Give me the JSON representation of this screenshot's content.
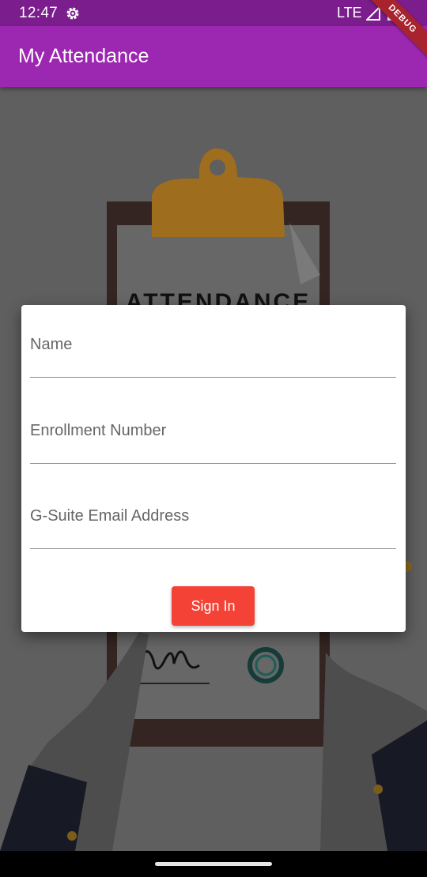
{
  "status_bar": {
    "time": "12:47",
    "network": "LTE",
    "icons": [
      "gear-icon",
      "signal-icon",
      "battery-icon"
    ]
  },
  "app_bar": {
    "title": "My Attendance",
    "color": "#9c27b0"
  },
  "debug_banner": {
    "label": "DEBUG"
  },
  "background": {
    "illustration": "attendance-clipboard-illustration",
    "heading_text": "ATTENDANCE"
  },
  "form": {
    "name_placeholder": "Name",
    "enrollment_placeholder": "Enrollment Number",
    "email_placeholder": "G-Suite Email Address",
    "sign_in_label": "Sign In",
    "button_color": "#f44336"
  }
}
